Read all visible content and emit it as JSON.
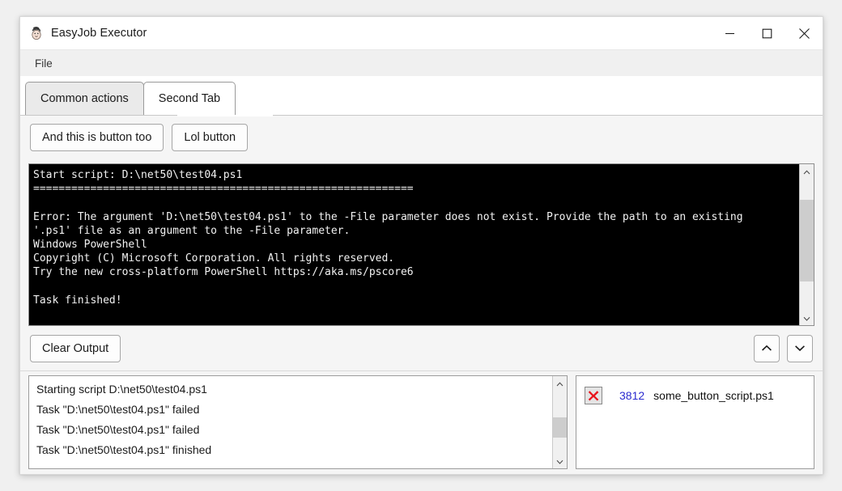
{
  "window": {
    "title": "EasyJob Executor",
    "icon": "app-icon",
    "controls": {
      "minimize": "minimize-icon",
      "maximize": "maximize-icon",
      "close": "close-icon"
    }
  },
  "menubar": {
    "items": [
      {
        "label": "File"
      }
    ]
  },
  "tabs": [
    {
      "label": "Common actions",
      "active": false
    },
    {
      "label": "Second Tab",
      "active": true
    }
  ],
  "tab_panel": {
    "buttons": [
      {
        "label": "And this is button too"
      },
      {
        "label": "Lol button"
      }
    ]
  },
  "console": {
    "lines": [
      "Start script: D:\\net50\\test04.ps1",
      "============================================================",
      "",
      "Error: The argument 'D:\\net50\\test04.ps1' to the -File parameter does not exist. Provide the path to an existing",
      "'.ps1' file as an argument to the -File parameter.",
      "Windows PowerShell",
      "Copyright (C) Microsoft Corporation. All rights reserved.",
      "Try the new cross-platform PowerShell https://aka.ms/pscore6",
      "",
      "Task finished!"
    ],
    "background": "#000000",
    "foreground": "#f2f2f2",
    "scrollbar": {
      "up_arrow": "chevron-up-icon",
      "down_arrow": "chevron-down-icon",
      "thumb_top_pct": 16,
      "thumb_height_pct": 62
    }
  },
  "actions": {
    "clear_output_label": "Clear Output",
    "scroll_up_icon": "chevron-up-icon",
    "scroll_down_icon": "chevron-down-icon"
  },
  "log_list": {
    "items": [
      "Starting script D:\\net50\\test04.ps1",
      "Task \"D:\\net50\\test04.ps1\" failed",
      "Task \"D:\\net50\\test04.ps1\" failed",
      "Task \"D:\\net50\\test04.ps1\" finished"
    ],
    "scrollbar": {
      "up_arrow": "chevron-up-icon",
      "down_arrow": "chevron-down-icon",
      "thumb_top_pct": 42,
      "thumb_height_pct": 32
    }
  },
  "process_list": {
    "items": [
      {
        "icon": "red-x-icon",
        "pid": "3812",
        "name": "some_button_script.ps1"
      }
    ],
    "pid_color": "#2b2bcf",
    "icon_color": "#e8131b"
  }
}
